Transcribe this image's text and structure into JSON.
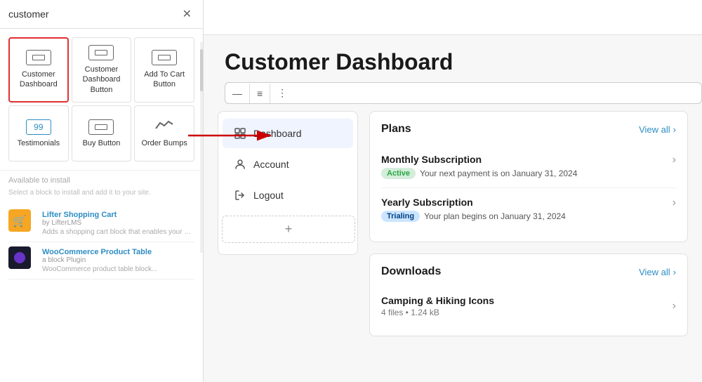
{
  "search": {
    "placeholder": "customer",
    "value": "customer"
  },
  "widgets": [
    {
      "id": "customer-dashboard",
      "label": "Customer\nDashboard",
      "selected": true
    },
    {
      "id": "customer-dashboard-button",
      "label": "Customer\nDashboard\nButton",
      "selected": false
    },
    {
      "id": "add-to-cart-button",
      "label": "Add To Cart\nButton",
      "selected": false
    },
    {
      "id": "testimonials",
      "label": "Testimonials",
      "selected": false
    },
    {
      "id": "buy-button",
      "label": "Buy Button",
      "selected": false
    },
    {
      "id": "order-bumps",
      "label": "Order Bumps",
      "selected": false
    }
  ],
  "divider": {
    "available_text": "Available to install",
    "desc": "Select a block to install and add it to your site."
  },
  "plugins": [
    {
      "name": "Lifter Shopping Cart",
      "meta": "by LifterLMS",
      "desc": "Adds a shopping cart block that enables your users to view their shopping cart, update their order..."
    },
    {
      "name": "WooCommerce Product Table",
      "meta": "a block Plugin",
      "desc": "WooCommerce product table block..."
    }
  ],
  "page": {
    "title": "Customer Dashboard"
  },
  "toolbar": {
    "btn1": "—",
    "btn2": "≡",
    "btn3": "⋮"
  },
  "nav": {
    "items": [
      {
        "id": "dashboard",
        "label": "Dashboard",
        "icon": "dashboard"
      },
      {
        "id": "account",
        "label": "Account",
        "icon": "user"
      },
      {
        "id": "logout",
        "label": "Logout",
        "icon": "logout"
      }
    ]
  },
  "plans": {
    "section_title": "Plans",
    "view_all": "View all",
    "items": [
      {
        "name": "Monthly Subscription",
        "status": "Active",
        "status_type": "active",
        "desc": "Your next payment is on January 31, 2024"
      },
      {
        "name": "Yearly Subscription",
        "status": "Trialing",
        "status_type": "trialing",
        "desc": "Your plan begins on January 31, 2024"
      }
    ]
  },
  "downloads": {
    "section_title": "Downloads",
    "view_all": "View all",
    "items": [
      {
        "name": "Camping & Hiking Icons",
        "meta": "4 files • 1.24 kB"
      }
    ]
  }
}
